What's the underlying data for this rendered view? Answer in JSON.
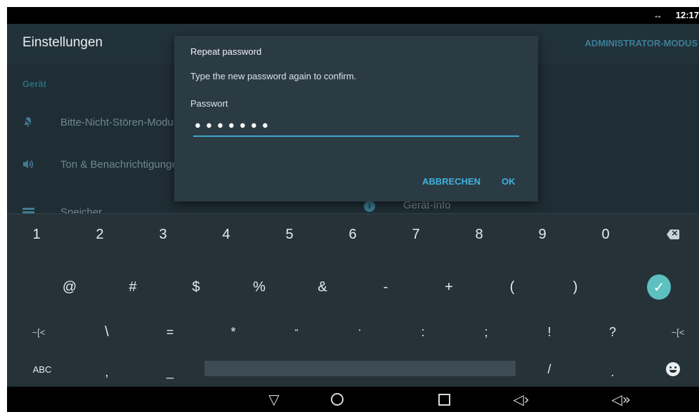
{
  "status_bar": {
    "connection_icon": "arrows-horizontal-icon",
    "connection_glyph": "↔",
    "time": "12:17"
  },
  "app_bar": {
    "title": "Einstellungen",
    "admin_mode": "ADMINISTRATOR-MODUS"
  },
  "settings": {
    "section": "Gerät",
    "items": [
      {
        "label": "Bitte-Nicht-Stören-Modus",
        "icon": "bell-off-icon"
      },
      {
        "label": "Ton & Benachrichtigungen",
        "icon": "volume-icon"
      },
      {
        "label": "Speicher",
        "icon": "storage-icon"
      },
      {
        "label": "Gerät-Info",
        "icon": "info-icon",
        "glyph": "i"
      }
    ]
  },
  "dialog": {
    "title": "Repeat password",
    "message": "Type the new password again to confirm.",
    "field_label": "Passwort",
    "field_value": "•••••••",
    "cancel": "ABBRECHEN",
    "ok": "OK"
  },
  "keyboard": {
    "row1": [
      "1",
      "2",
      "3",
      "4",
      "5",
      "6",
      "7",
      "8",
      "9",
      "0"
    ],
    "row2": [
      "@",
      "#",
      "$",
      "%",
      "&",
      "-",
      "+",
      "(",
      ")"
    ],
    "row3": [
      "~[<",
      "\\",
      "=",
      "*",
      "\"",
      "'",
      ":",
      ";",
      "!",
      "?",
      "~[<"
    ],
    "row4": {
      "abc": "ABC",
      "comma": ",",
      "underscore": "_",
      "slash": "/",
      "period": "."
    },
    "enter_glyph": "✓",
    "accent": "#5ec0c1"
  },
  "nav_bar": {
    "back": "▽",
    "vol_down": "◁›",
    "vol_up": "◁»"
  }
}
